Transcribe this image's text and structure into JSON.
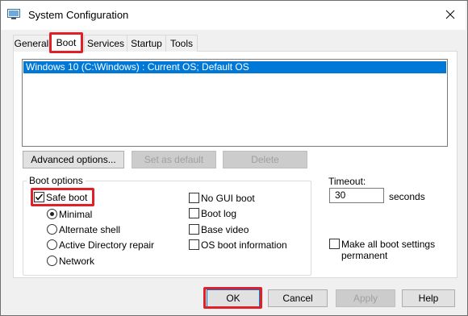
{
  "window": {
    "title": "System Configuration"
  },
  "tabs": [
    {
      "label": "General"
    },
    {
      "label": "Boot"
    },
    {
      "label": "Services"
    },
    {
      "label": "Startup"
    },
    {
      "label": "Tools"
    }
  ],
  "os_list": {
    "items": [
      "Windows 10 (C:\\Windows) : Current OS; Default OS"
    ]
  },
  "buttons": {
    "advanced": "Advanced options...",
    "set_default": "Set as default",
    "delete": "Delete"
  },
  "boot_options": {
    "label": "Boot options",
    "safe_boot": {
      "label": "Safe boot",
      "checked": true
    },
    "radios": [
      {
        "label": "Minimal",
        "checked": true
      },
      {
        "label": "Alternate shell",
        "checked": false
      },
      {
        "label": "Active Directory repair",
        "checked": false
      },
      {
        "label": "Network",
        "checked": false
      }
    ],
    "checks": [
      {
        "label": "No GUI boot",
        "checked": false
      },
      {
        "label": "Boot log",
        "checked": false
      },
      {
        "label": "Base video",
        "checked": false
      },
      {
        "label": "OS boot information",
        "checked": false
      }
    ]
  },
  "timeout": {
    "label": "Timeout:",
    "value": "30",
    "unit": "seconds"
  },
  "make_permanent": {
    "label_line1": "Make all boot settings",
    "label_line2": "permanent",
    "checked": false
  },
  "footer": {
    "ok": "OK",
    "cancel": "Cancel",
    "apply": "Apply",
    "help": "Help"
  },
  "colors": {
    "selection": "#0078d7",
    "highlight": "#e01f26"
  }
}
